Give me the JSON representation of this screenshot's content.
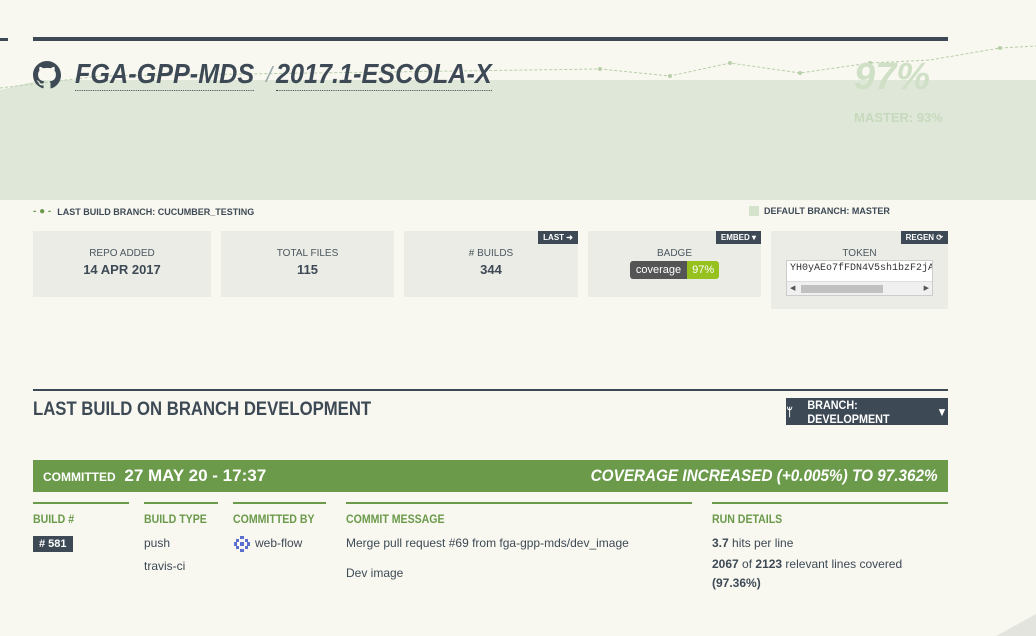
{
  "repo": {
    "owner": "FGA-GPP-MDS",
    "separator": "/",
    "name": "2017.1-ESCOLA-X",
    "coverage": "97%",
    "master_coverage": "MASTER: 93%"
  },
  "legend": {
    "last_build_branch": "LAST BUILD BRANCH: CUCUMBER_TESTING",
    "default_branch": "DEFAULT BRANCH: MASTER"
  },
  "stats": {
    "repo_added_label": "REPO ADDED",
    "repo_added_value": "14 APR 2017",
    "total_files_label": "TOTAL FILES",
    "total_files_value": "115",
    "builds_label": "# BUILDS",
    "builds_value": "344",
    "builds_corner": "LAST",
    "badge_label": "BADGE",
    "badge_corner": "EMBED ▾",
    "badge_left": "coverage",
    "badge_right": "97%",
    "token_label": "TOKEN",
    "token_corner": "REGEN",
    "token_value": "YH0yAEo7fFDN4V5sh1bzF2jA"
  },
  "section": {
    "title": "LAST BUILD ON BRANCH DEVELOPMENT",
    "branch_button": "BRANCH: DEVELOPMENT"
  },
  "commit": {
    "committed_label": "COMMITTED",
    "committed_date": "27 MAY 20 - 17:37",
    "coverage_change": "COVERAGE INCREASED (+0.005%) TO 97.362%"
  },
  "details": {
    "build_header": "BUILD #",
    "build_number": "# 581",
    "type_header": "BUILD TYPE",
    "type_line1": "push",
    "type_line2": "travis-ci",
    "by_header": "COMMITTED BY",
    "by_user": "web-flow",
    "msg_header": "COMMIT MESSAGE",
    "msg_line1": "Merge pull request #69 from fga-gpp-mds/dev_image",
    "msg_line2": "Dev image",
    "run_header": "RUN DETAILS",
    "hits_value": "3.7",
    "hits_text": " hits per line",
    "lines_covered": "2067",
    "of_text": " of ",
    "lines_total": "2123",
    "lines_text": " relevant lines covered",
    "pct": "(97.36%)"
  },
  "colors": {
    "dark": "#3d4a55",
    "green": "#6a9a4a",
    "area": "#dfe8d8"
  }
}
